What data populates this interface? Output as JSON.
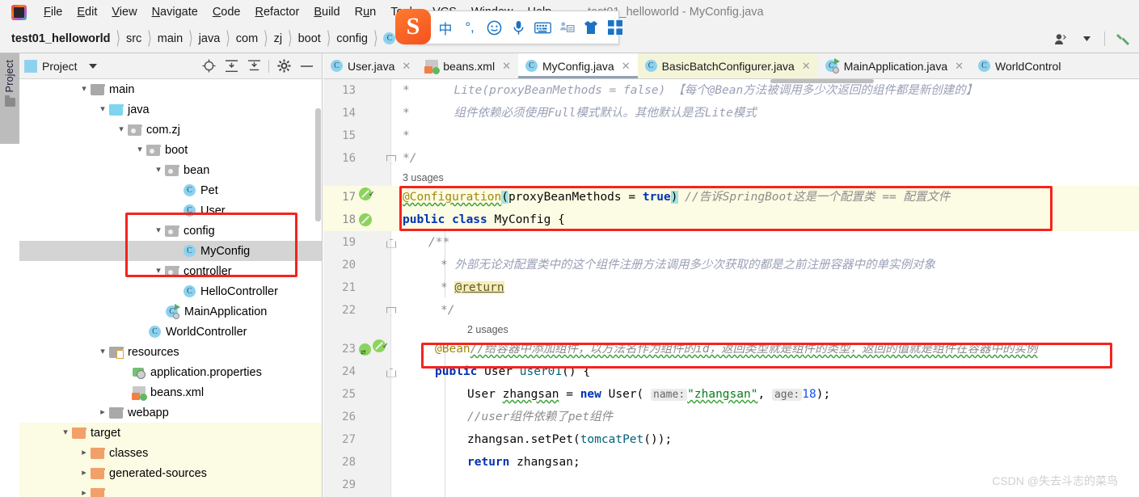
{
  "window": {
    "title": "test01_helloworld - MyConfig.java"
  },
  "menu": {
    "items": [
      {
        "label": "File"
      },
      {
        "label": "Edit"
      },
      {
        "label": "View"
      },
      {
        "label": "Navigate"
      },
      {
        "label": "Code"
      },
      {
        "label": "Refactor"
      },
      {
        "label": "Build"
      },
      {
        "label": "Run"
      },
      {
        "label": "Tools"
      },
      {
        "label": "VCS"
      },
      {
        "label": "Window"
      },
      {
        "label": "Help"
      }
    ]
  },
  "ime_toolbar": {
    "logo": "S",
    "icons": [
      {
        "name": "chinese-mode-icon",
        "glyph": "中"
      },
      {
        "name": "punctuation-icon",
        "glyph": "°,"
      },
      {
        "name": "emoji-icon",
        "glyph": "☺"
      },
      {
        "name": "voice-input-icon",
        "glyph": "🎤"
      },
      {
        "name": "soft-keyboard-icon",
        "glyph": "⌨"
      },
      {
        "name": "user-dictionary-icon",
        "glyph": "👤"
      },
      {
        "name": "skin-icon",
        "glyph": "👕"
      },
      {
        "name": "toolbox-icon",
        "glyph": "▦"
      }
    ]
  },
  "breadcrumb": {
    "items": [
      {
        "label": "test01_helloworld",
        "bold": true,
        "icon": ""
      },
      {
        "label": "src",
        "bold": false,
        "icon": ""
      },
      {
        "label": "main",
        "bold": false,
        "icon": ""
      },
      {
        "label": "java",
        "bold": false,
        "icon": ""
      },
      {
        "label": "com",
        "bold": false,
        "icon": ""
      },
      {
        "label": "zj",
        "bold": false,
        "icon": ""
      },
      {
        "label": "boot",
        "bold": false,
        "icon": ""
      },
      {
        "label": "config",
        "bold": false,
        "icon": ""
      },
      {
        "label": "MyConfig",
        "bold": false,
        "icon": "class-icon"
      }
    ],
    "right_icons": [
      {
        "name": "user-account-icon",
        "glyph": "👤"
      },
      {
        "name": "build-hammer-icon",
        "glyph": "🔨"
      }
    ]
  },
  "tool_stripe": {
    "project_tab": "Project"
  },
  "project_panel": {
    "title": "Project",
    "toolbar_icons": [
      {
        "name": "locate-target-icon"
      },
      {
        "name": "expand-all-icon"
      },
      {
        "name": "collapse-all-icon"
      },
      {
        "name": "settings-gear-icon"
      },
      {
        "name": "hide-panel-icon"
      }
    ],
    "tree": [
      {
        "label": "main",
        "indent": 3,
        "arrow": "v",
        "icon": "folder-grey",
        "state": "normal"
      },
      {
        "label": "java",
        "indent": 4,
        "arrow": "v",
        "icon": "folder-blue",
        "state": "normal"
      },
      {
        "label": "com.zj",
        "indent": 5,
        "arrow": "v",
        "icon": "package",
        "state": "normal"
      },
      {
        "label": "boot",
        "indent": 6,
        "arrow": "v",
        "icon": "package",
        "state": "normal"
      },
      {
        "label": "bean",
        "indent": 7,
        "arrow": "v",
        "icon": "package",
        "state": "normal"
      },
      {
        "label": "Pet",
        "indent": 8,
        "arrow": "",
        "icon": "class",
        "state": "normal"
      },
      {
        "label": "User",
        "indent": 8,
        "arrow": "",
        "icon": "class",
        "state": "normal"
      },
      {
        "label": "config",
        "indent": 7,
        "arrow": "v",
        "icon": "package",
        "state": "normal"
      },
      {
        "label": "MyConfig",
        "indent": 8,
        "arrow": "",
        "icon": "class",
        "state": "selected"
      },
      {
        "label": "controller",
        "indent": 7,
        "arrow": "v",
        "icon": "package",
        "state": "normal"
      },
      {
        "label": "HelloController",
        "indent": 8,
        "arrow": "",
        "icon": "class",
        "state": "normal"
      },
      {
        "label": "MainApplication",
        "indent": 7,
        "arrow": "",
        "icon": "runnable-class",
        "state": "normal"
      },
      {
        "label": "WorldController",
        "indent": 6,
        "arrow": "",
        "icon": "class",
        "state": "normal"
      },
      {
        "label": "resources",
        "indent": 5,
        "arrow": "v",
        "icon": "folder-resources",
        "state": "normal"
      },
      {
        "label": "application.properties",
        "indent": 6,
        "arrow": "",
        "icon": "properties",
        "state": "normal"
      },
      {
        "label": "beans.xml",
        "indent": 6,
        "arrow": "",
        "icon": "xml",
        "state": "normal"
      },
      {
        "label": "webapp",
        "indent": 5,
        "arrow": ">",
        "icon": "folder-grey",
        "state": "normal"
      },
      {
        "label": "target",
        "indent": 3,
        "arrow": "v",
        "icon": "folder-orange",
        "state": "target"
      },
      {
        "label": "classes",
        "indent": 4,
        "arrow": ">",
        "icon": "folder-orange",
        "state": "target"
      },
      {
        "label": "generated-sources",
        "indent": 4,
        "arrow": ">",
        "icon": "folder-orange",
        "state": "target"
      },
      {
        "label": "",
        "indent": 4,
        "arrow": ">",
        "icon": "folder-orange",
        "state": "target"
      }
    ]
  },
  "editor": {
    "tabs": [
      {
        "label": "User.java",
        "icon": "class-icon",
        "state": "normal"
      },
      {
        "label": "beans.xml",
        "icon": "xml-icon",
        "state": "normal"
      },
      {
        "label": "MyConfig.java",
        "icon": "class-icon",
        "state": "active"
      },
      {
        "label": "BasicBatchConfigurer.java",
        "icon": "class-icon",
        "state": "yellow"
      },
      {
        "label": "MainApplication.java",
        "icon": "runnable-class-icon",
        "state": "normal"
      },
      {
        "label": "WorldControl",
        "icon": "class-icon",
        "state": "normal"
      }
    ],
    "usages_17": "3 usages",
    "usages_23": "2 usages",
    "lines": [
      {
        "num": "13"
      },
      {
        "num": "14"
      },
      {
        "num": "15"
      },
      {
        "num": "16"
      },
      {
        "num": "17"
      },
      {
        "num": "18"
      },
      {
        "num": "19"
      },
      {
        "num": "20"
      },
      {
        "num": "21"
      },
      {
        "num": "22"
      },
      {
        "num": "23"
      },
      {
        "num": "24"
      },
      {
        "num": "25"
      },
      {
        "num": "26"
      },
      {
        "num": "27"
      },
      {
        "num": "28"
      },
      {
        "num": "29"
      }
    ],
    "code": {
      "l13_star": "*",
      "l13_text": "Lite(proxyBeanMethods = false) 【每个@Bean方法被调用多少次返回的组件都是新创建的】",
      "l14_star": "*",
      "l14_text": "组件依赖必须使用Full模式默认。其他默认是否Lite模式",
      "l15_star": "*",
      "l16_text": "*/",
      "l17_anno": "@Configuration",
      "l17_open": "(",
      "l17_param": "proxyBeanMethods",
      "l17_eq": " = ",
      "l17_true": "true",
      "l17_close": ")",
      "l17_comment": "//告诉SpringBoot这是一个配置类 == 配置文件",
      "l18_kw": "public class ",
      "l18_name": "MyConfig",
      "l18_brace": " {",
      "l19": "/**",
      "l20_star": "* ",
      "l20_text": "外部无论对配置类中的这个组件注册方法调用多少次获取的都是之前注册容器中的单实例对象",
      "l21_star": "* ",
      "l21_tag": "@return",
      "l22": "*/",
      "l23_anno": "@Bean",
      "l23_comment": "//给容器中添加组件，以方法名作为组件的id，返回类型就是组件的类型，返回的值就是组件在容器中的实例",
      "l24_kw": "public ",
      "l24_type": "User ",
      "l24_name": "user01",
      "l24_rest": "() {",
      "l25_type": "User ",
      "l25_var": "zhangsan",
      "l25_eq": " =  ",
      "l25_new": "new ",
      "l25_ctor": "User",
      "l25_paren": "( ",
      "l25_hint1": "name:",
      "l25_str": "\"zhangsan\"",
      "l25_comma": ",  ",
      "l25_hint2": "age:",
      "l25_num": "18",
      "l25_end": ");",
      "l26_comment": "//user组件依赖了pet组件",
      "l27_a": "zhangsan.",
      "l27_b": "setPet",
      "l27_c": "(",
      "l27_d": "tomcatPet",
      "l27_e": "());",
      "l28_kw": "return ",
      "l28_var": "zhangsan;"
    }
  },
  "watermark": "CSDN @失去斗志的菜鸟",
  "colors": {
    "annotation_box": "#f5231d",
    "highlight_line": "#fcfbe3",
    "keyword": "#0033b3",
    "string": "#067d17",
    "comment": "#8c8c8c"
  }
}
